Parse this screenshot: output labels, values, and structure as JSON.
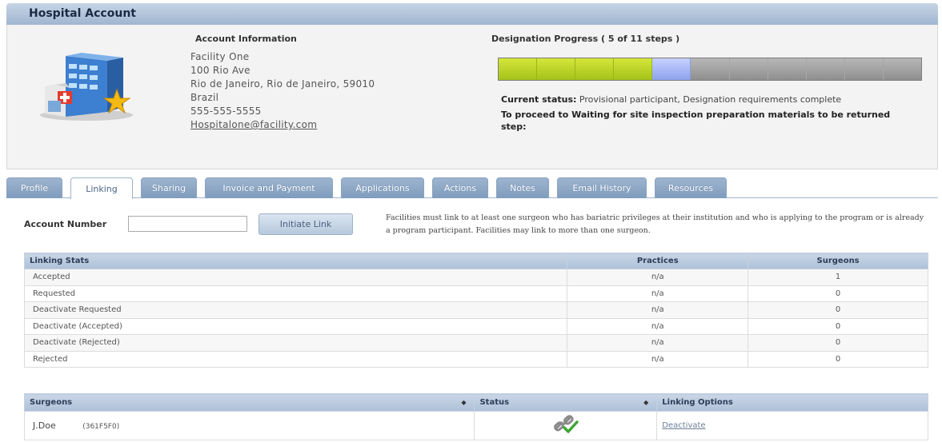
{
  "header": {
    "title": "Hospital Account"
  },
  "account": {
    "heading": "Account Information",
    "lines": [
      "Facility One",
      "100 Rio Ave",
      "Rio de Janeiro, Rio de Janeiro, 59010",
      "Brazil",
      "555-555-5555"
    ],
    "email": "Hospitalone@facility.com"
  },
  "progress": {
    "heading": "Designation Progress ( 5 of 11 steps )",
    "completed_steps": 5,
    "total_steps": 11,
    "status_label": "Current status:",
    "status_value": "Provisional participant, Designation requirements complete",
    "proceed_text": "To proceed to Waiting for site inspection preparation materials to be returned step:",
    "colors": {
      "done": "#a5c21a",
      "current": "#8ea3ee",
      "todo": "#9c9c9c"
    }
  },
  "tabs": [
    {
      "label": "Profile",
      "active": false
    },
    {
      "label": "Linking",
      "active": true
    },
    {
      "label": "Sharing",
      "active": false
    },
    {
      "label": "Invoice and Payment",
      "active": false
    },
    {
      "label": "Applications",
      "active": false
    },
    {
      "label": "Actions",
      "active": false
    },
    {
      "label": "Notes",
      "active": false
    },
    {
      "label": "Email History",
      "active": false
    },
    {
      "label": "Resources",
      "active": false
    }
  ],
  "linking": {
    "account_number_label": "Account Number",
    "account_number_value": "",
    "initiate_button": "Initiate Link",
    "info": "Facilities must link to at least one surgeon who has bariatric privileges at their institution and who is applying to the program or is already a program participant. Facilities may link to more than one surgeon."
  },
  "stats_table": {
    "headers": [
      "Linking Stats",
      "Practices",
      "Surgeons"
    ],
    "rows": [
      [
        "Accepted",
        "n/a",
        "1"
      ],
      [
        "Requested",
        "n/a",
        "0"
      ],
      [
        "Deactivate Requested",
        "n/a",
        "0"
      ],
      [
        "Deactivate (Accepted)",
        "n/a",
        "0"
      ],
      [
        "Deactivate (Rejected)",
        "n/a",
        "0"
      ],
      [
        "Rejected",
        "n/a",
        "0"
      ]
    ]
  },
  "surgeons_table": {
    "headers": [
      "Surgeons",
      "Status",
      "Linking Options"
    ],
    "rows": [
      {
        "name": "J.Doe",
        "code": "(361F5F0)",
        "status_icon": "linked-check-icon",
        "option": "Deactivate"
      }
    ]
  }
}
